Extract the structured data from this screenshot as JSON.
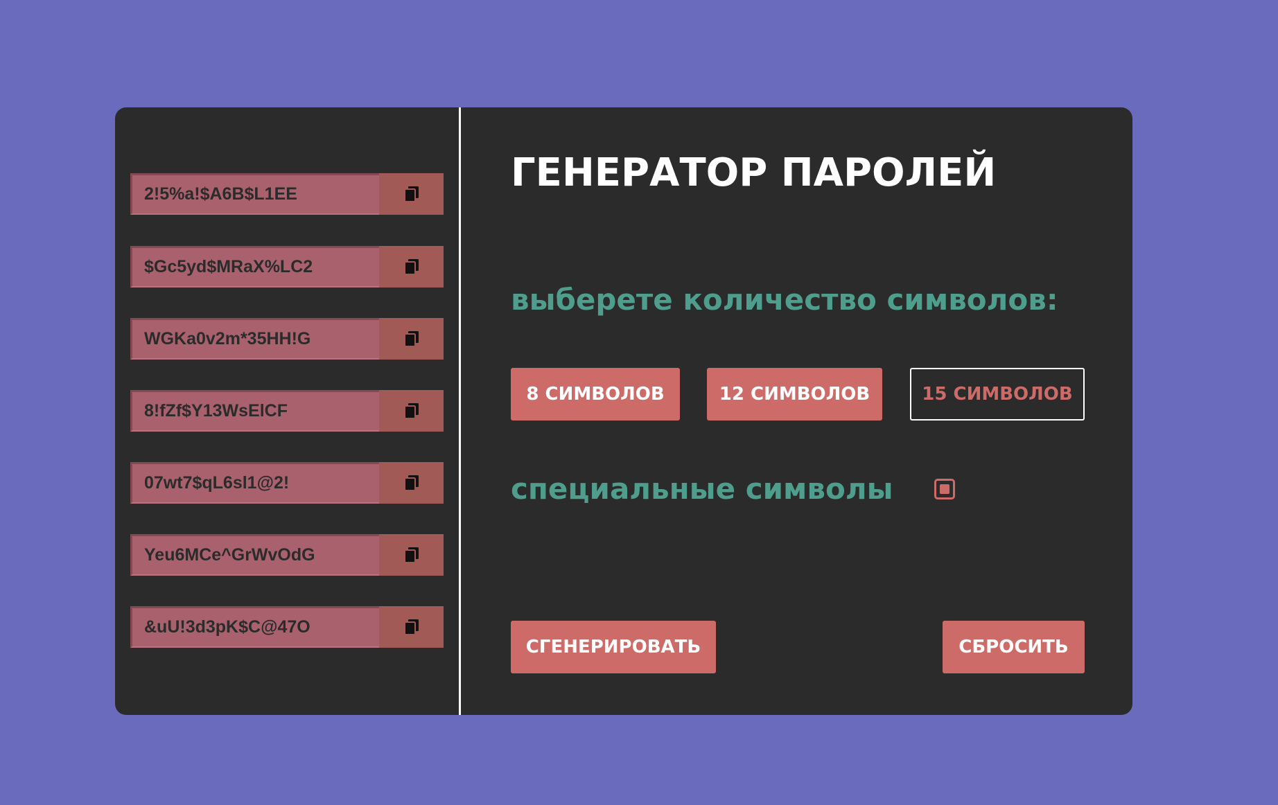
{
  "colors": {
    "background": "#6b6bbd",
    "card": "#2b2b2b",
    "accent": "#cd6b68",
    "teal": "#4e9d8d",
    "password_field": "#a9616d",
    "copy_button": "#a15a56"
  },
  "passwords": [
    {
      "value": "2!5%a!$A6B$L1EE",
      "copy_icon": "copy-icon"
    },
    {
      "value": "$Gc5yd$MRaX%LC2",
      "copy_icon": "copy-icon"
    },
    {
      "value": "WGKa0v2m*35HH!G",
      "copy_icon": "copy-icon"
    },
    {
      "value": "8!fZf$Y13WsElCF",
      "copy_icon": "copy-icon"
    },
    {
      "value": "07wt7$qL6sl1@2!",
      "copy_icon": "copy-icon"
    },
    {
      "value": "Yeu6MCe^GrWvOdG",
      "copy_icon": "copy-icon"
    },
    {
      "value": "&uU!3d3pK$C@47O",
      "copy_icon": "copy-icon"
    }
  ],
  "generator": {
    "title": "ГЕНЕРАТОР ПАРОЛЕЙ",
    "length_prompt": "выберете количество символов:",
    "length_options": [
      {
        "label": "8 СИМВОЛОВ",
        "selected": false
      },
      {
        "label": "12 СИМВОЛОВ",
        "selected": false
      },
      {
        "label": "15 СИМВОЛОВ",
        "selected": true
      }
    ],
    "special_chars_label": "специальные символы",
    "special_chars_checked": true,
    "generate_label": "СГЕНЕРИРОВАТЬ",
    "reset_label": "СБРОСИТЬ"
  }
}
